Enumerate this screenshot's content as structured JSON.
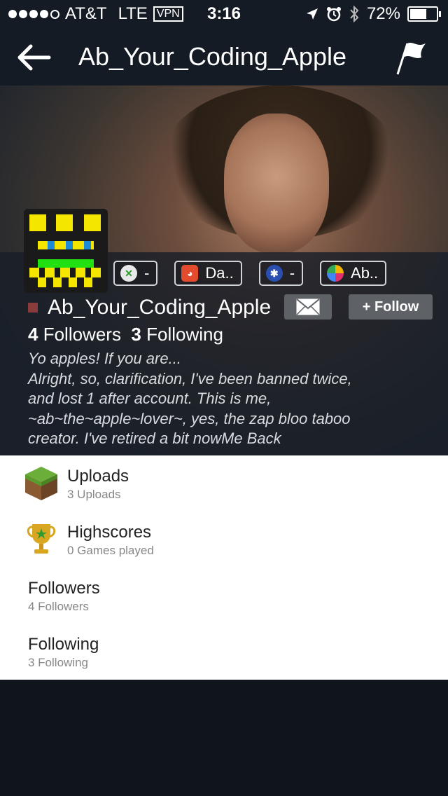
{
  "status_bar": {
    "carrier": "AT&T",
    "network": "LTE",
    "vpn": "VPN",
    "time": "3:16",
    "battery": "72%",
    "battery_level": 0.72
  },
  "nav": {
    "title": "Ab_Your_Coding_Apple"
  },
  "profile": {
    "name": "Ab_Your_Coding_Apple",
    "follow_label": "+ Follow",
    "followers_count": "4",
    "followers_label": "Followers",
    "following_count": "3",
    "following_label": "Following",
    "bio_line1": "Yo apples! If you are...",
    "bio_line2": "Alright, so, clarification, I've been banned twice,",
    "bio_line3": "and lost 1 after account. This is me,",
    "bio_line4": "~ab~the~apple~lover~, yes, the zap bloo taboo",
    "bio_line5": "creator. I've retired a bit nowMe Back"
  },
  "badges": [
    {
      "icon": "xbox-icon",
      "label": "-"
    },
    {
      "icon": "app-icon",
      "label": "Da.."
    },
    {
      "icon": "playstation-icon",
      "label": "-"
    },
    {
      "icon": "game-center-icon",
      "label": "Ab.."
    }
  ],
  "list": [
    {
      "icon": "grass-block-icon",
      "title": "Uploads",
      "subtitle": "3 Uploads"
    },
    {
      "icon": "trophy-icon",
      "title": "Highscores",
      "subtitle": "0 Games played"
    },
    {
      "title": "Followers",
      "subtitle": "4 Followers"
    },
    {
      "title": "Following",
      "subtitle": "3 Following"
    }
  ],
  "colors": {
    "background": "#10151d",
    "navbar": "#141b24",
    "button": "#5e6266",
    "status_square": "#8a3b3b"
  }
}
